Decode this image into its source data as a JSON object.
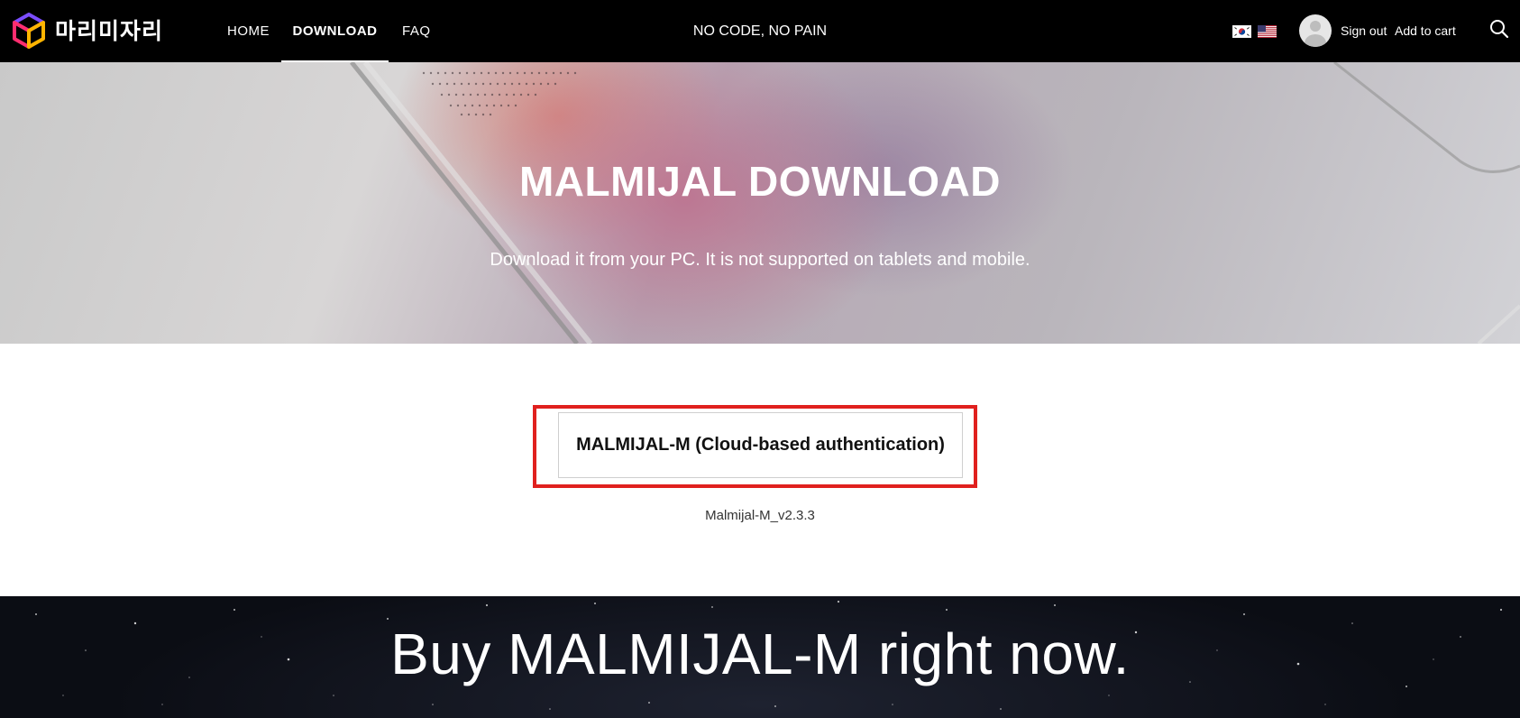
{
  "brand": {
    "logo_text": "마리미자리"
  },
  "nav": {
    "items": [
      {
        "label": "HOME",
        "active": false
      },
      {
        "label": "DOWNLOAD",
        "active": true
      },
      {
        "label": "FAQ",
        "active": false
      }
    ],
    "tagline": "NO CODE, NO PAIN",
    "languages": [
      "korean-flag-icon",
      "us-flag-icon"
    ],
    "sign_out": "Sign out",
    "add_to_cart": "Add to cart",
    "search_icon": "search-icon"
  },
  "hero": {
    "title": "MALMIJAL DOWNLOAD",
    "subtitle": "Download it from your PC. It is not supported on tablets and mobile."
  },
  "download": {
    "button_label": "MALMIJAL-M (Cloud-based authentication)",
    "version": "Malmijal-M_v2.3.3",
    "highlight_color": "#e0201e"
  },
  "banner": {
    "title": "Buy MALMIJAL-M right now."
  }
}
